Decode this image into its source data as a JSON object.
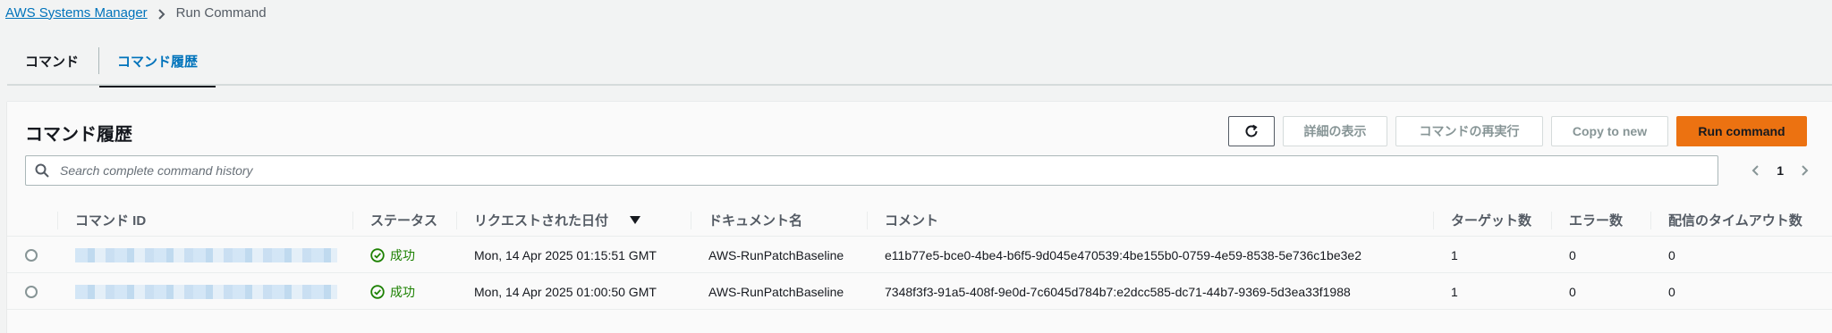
{
  "breadcrumb": {
    "parent": "AWS Systems Manager",
    "current": "Run Command"
  },
  "tabs": [
    {
      "label": "コマンド",
      "active": false
    },
    {
      "label": "コマンド履歴",
      "active": true
    }
  ],
  "panel": {
    "title": "コマンド履歴"
  },
  "actions": {
    "refresh_icon": "refresh-icon",
    "view_details": "詳細の表示",
    "rerun": "コマンドの再実行",
    "copy_to_new": "Copy to new",
    "run_command": "Run command"
  },
  "search": {
    "placeholder": "Search complete command history"
  },
  "pagination": {
    "current_page": "1"
  },
  "table": {
    "columns": {
      "command_id": "コマンド ID",
      "status": "ステータス",
      "requested": "リクエストされた日付",
      "document": "ドキュメント名",
      "comment": "コメント",
      "targets": "ターゲット数",
      "errors": "エラー数",
      "delivery_timeout": "配信のタイムアウト数"
    },
    "rows": [
      {
        "status": "成功",
        "requested": "Mon, 14 Apr 2025 01:15:51 GMT",
        "document": "AWS-RunPatchBaseline",
        "comment": "e11b77e5-bce0-4be4-b6f5-9d045e470539:4be155b0-0759-4e59-8538-5e736c1be3e2",
        "targets": "1",
        "errors": "0",
        "delivery_timeout": "0"
      },
      {
        "status": "成功",
        "requested": "Mon, 14 Apr 2025 01:00:50 GMT",
        "document": "AWS-RunPatchBaseline",
        "comment": "7348f3f3-91a5-408f-9e0d-7c6045d784b7:e2dcc585-dc71-44b7-9369-5d3ea33f1988",
        "targets": "1",
        "errors": "0",
        "delivery_timeout": "0"
      }
    ]
  },
  "colors": {
    "link": "#0073bb",
    "primary": "#ec7211",
    "success": "#1d8102"
  }
}
